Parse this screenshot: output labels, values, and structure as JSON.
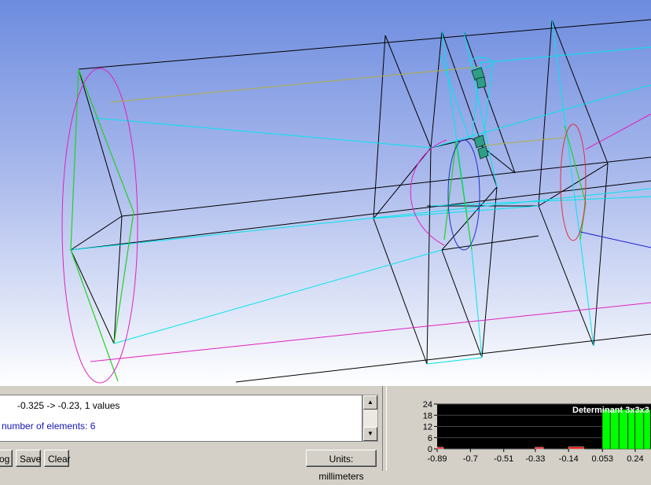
{
  "log": {
    "line1": "-0.325 -> -0.23, 1 values",
    "line2": "number of elements: 6",
    "scroll_up": "▲",
    "scroll_down": "▼"
  },
  "toolbar": {
    "log_label": "og",
    "save_label": "Save",
    "clear_label": "Clear",
    "units_label": "Units: millimeters"
  },
  "colors": {
    "viewport_top": "#6d8cdf",
    "viewport_bottom": "#ffffff",
    "hist_background": "#000000",
    "hist_bar_green": "#00ff00",
    "hist_bar_red": "#ff0000"
  },
  "chart_data": {
    "type": "bar",
    "title": "Determinant 3x3x3",
    "x_ticks": [
      "-0.89",
      "-0.7",
      "-0.51",
      "-0.33",
      "-0.14",
      "0.053",
      "0.24"
    ],
    "x_tick_values": [
      -0.89,
      -0.7,
      -0.51,
      -0.33,
      -0.14,
      0.053,
      0.24
    ],
    "y_ticks": [
      "24",
      "18",
      "12",
      "6",
      "0"
    ],
    "y_tick_values": [
      24,
      18,
      12,
      6,
      0
    ],
    "ylim": [
      0,
      24
    ],
    "xlim": [
      -0.89,
      0.33
    ],
    "bins": [
      {
        "from": -0.89,
        "to": -0.85,
        "count": 0.5,
        "color": "red"
      },
      {
        "from": -0.33,
        "to": -0.28,
        "count": 0.5,
        "color": "red"
      },
      {
        "from": -0.14,
        "to": -0.05,
        "count": 1,
        "color": "red"
      },
      {
        "from": 0.053,
        "to": 0.1,
        "count": 21,
        "color": "green"
      },
      {
        "from": 0.1,
        "to": 0.15,
        "count": 21,
        "color": "green"
      },
      {
        "from": 0.15,
        "to": 0.2,
        "count": 21,
        "color": "green"
      },
      {
        "from": 0.2,
        "to": 0.24,
        "count": 21,
        "color": "green"
      },
      {
        "from": 0.24,
        "to": 0.29,
        "count": 21,
        "color": "green"
      },
      {
        "from": 0.29,
        "to": 0.33,
        "count": 21,
        "color": "green"
      }
    ]
  }
}
